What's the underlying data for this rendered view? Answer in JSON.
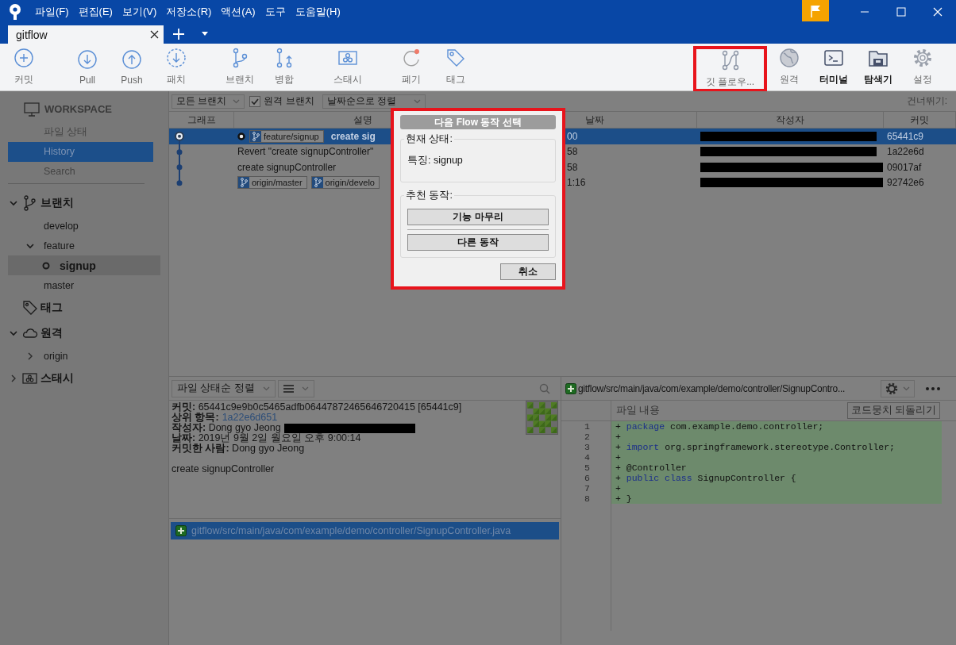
{
  "title_bar": {
    "menu": [
      "파일(F)",
      "편집(E)",
      "보기(V)",
      "저장소(R)",
      "액션(A)",
      "도구",
      "도움말(H)"
    ]
  },
  "tabs": [
    {
      "label": "gitflow",
      "selected": true
    }
  ],
  "toolbar": {
    "left": [
      {
        "label": "커밋"
      },
      {
        "label": "Pull"
      },
      {
        "label": "Push"
      },
      {
        "label": "패치"
      },
      {
        "label": "브랜치"
      },
      {
        "label": "병합"
      },
      {
        "label": "스태시"
      },
      {
        "label": "폐기"
      },
      {
        "label": "태그"
      }
    ],
    "right": [
      {
        "label": "깃 플로우...",
        "bold": false,
        "outlined": true
      },
      {
        "label": "원격",
        "bold": false,
        "outlined": false
      },
      {
        "label": "터미널",
        "bold": true,
        "outlined": false
      },
      {
        "label": "탐색기",
        "bold": true,
        "outlined": false
      },
      {
        "label": "설정",
        "bold": false,
        "outlined": false
      }
    ]
  },
  "sidebar": {
    "workspace": {
      "title": "WORKSPACE",
      "items": [
        {
          "label": "파일 상태",
          "selected": false
        },
        {
          "label": "History",
          "selected": true
        },
        {
          "label": "Search",
          "selected": false
        }
      ]
    },
    "sections": [
      {
        "label": "브랜치",
        "expanded": true,
        "children": [
          {
            "label": "develop",
            "selected": false,
            "current": false
          },
          {
            "label": "feature",
            "selected": false,
            "current": false,
            "expanded": true,
            "children": [
              {
                "label": "signup",
                "selected": true,
                "current": true
              }
            ]
          },
          {
            "label": "master",
            "selected": false,
            "current": false
          }
        ]
      },
      {
        "label": "태그"
      },
      {
        "label": "원격",
        "expanded": true,
        "children": [
          {
            "label": "origin",
            "selected": false,
            "current": false,
            "expanded": false
          }
        ]
      },
      {
        "label": "스태시",
        "expanded": false
      }
    ]
  },
  "history": {
    "branch_filter": "모든 브랜치",
    "remote_branches": {
      "label": "원격 브랜치",
      "checked": true
    },
    "sort": "날짜순으로 정렬",
    "jump_label": "건너뛰기:",
    "columns": [
      "그래프",
      "설명",
      "날짜",
      "작성자",
      "커밋"
    ],
    "rows": [
      {
        "head": true,
        "selected": true,
        "refs": [
          {
            "label": "feature/signup",
            "current": true
          }
        ],
        "description": "create sig",
        "date": "00",
        "commit": "65441c9"
      },
      {
        "head": false,
        "selected": false,
        "refs": [],
        "description": "Revert \"create signupController\"",
        "date": "58",
        "commit": "1a22e6d"
      },
      {
        "head": false,
        "selected": false,
        "refs": [],
        "description": "create signupController",
        "date": "58",
        "commit": "09017af"
      },
      {
        "head": false,
        "selected": false,
        "refs": [
          {
            "label": "origin/master",
            "current": false
          },
          {
            "label": "origin/develo",
            "current": false
          }
        ],
        "date": "1:16",
        "commit": "92742e6"
      }
    ]
  },
  "details": {
    "sort": "파일 상태순 정렬",
    "fields": [
      {
        "label": "커밋:",
        "value": "65441c9e9b0c5465adfb06447872465646720415 [65441c9]",
        "kind": "text"
      },
      {
        "label": "상위 항목:",
        "value": "1a22e6d651",
        "kind": "link"
      },
      {
        "label": "작성자:",
        "value": "Dong gyo Jeong",
        "kind": "redacted"
      },
      {
        "label": "날짜:",
        "value": "2019년 9월 2일 월요일 오후 9:00:14",
        "kind": "text"
      },
      {
        "label": "커밋한 사람:",
        "value": "Dong gyo Jeong",
        "kind": "text"
      }
    ],
    "message": "create signupController",
    "files": [
      {
        "path": "gitflow/src/main/java/com/example/demo/controller/SignupController.java",
        "selected": true
      }
    ]
  },
  "diff": {
    "path": "gitflow/src/main/java/com/example/demo/controller/SignupContro...",
    "hunk_title": "파일 내용",
    "revert_button": "코드뭉치 되돌리기",
    "lines": [
      {
        "number": "1",
        "parts": [
          {
            "kind": "plain",
            "text": "+ "
          },
          {
            "kind": "keyword",
            "text": "package"
          },
          {
            "kind": "plain",
            "text": " com.example.demo.controller;"
          }
        ]
      },
      {
        "number": "2",
        "parts": [
          {
            "kind": "plain",
            "text": "+"
          }
        ]
      },
      {
        "number": "3",
        "parts": [
          {
            "kind": "plain",
            "text": "+ "
          },
          {
            "kind": "keyword",
            "text": "import"
          },
          {
            "kind": "plain",
            "text": " org.springframework.stereotype.Controller;"
          }
        ]
      },
      {
        "number": "4",
        "parts": [
          {
            "kind": "plain",
            "text": "+"
          }
        ]
      },
      {
        "number": "5",
        "parts": [
          {
            "kind": "plain",
            "text": "+ @Controller"
          }
        ]
      },
      {
        "number": "6",
        "parts": [
          {
            "kind": "plain",
            "text": "+ "
          },
          {
            "kind": "keyword",
            "text": "public class"
          },
          {
            "kind": "plain",
            "text": " SignupController {"
          }
        ]
      },
      {
        "number": "7",
        "parts": [
          {
            "kind": "plain",
            "text": "+"
          }
        ]
      },
      {
        "number": "8",
        "parts": [
          {
            "kind": "plain",
            "text": "+ }"
          }
        ]
      }
    ]
  },
  "flow_dialog": {
    "title": "다음 Flow 동작 선택",
    "outlined": true,
    "current_state": {
      "legend": "현재 상태:",
      "text": "특징: signup"
    },
    "suggested": {
      "legend": "추천 동작:",
      "actions": [
        "기능 마무리",
        "다른 동작"
      ]
    },
    "cancel": "취소"
  }
}
